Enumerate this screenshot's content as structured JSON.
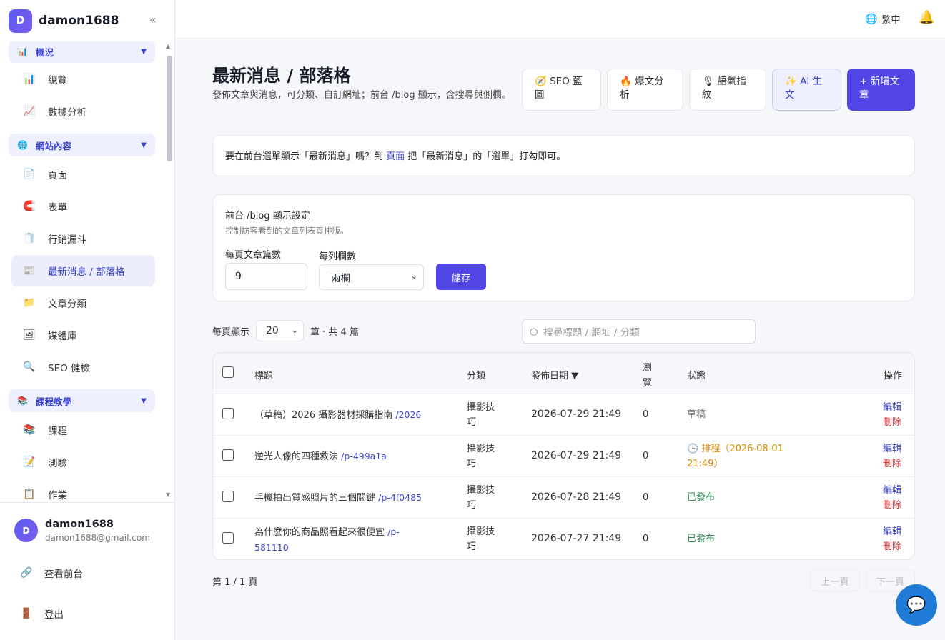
{
  "brand": {
    "initial": "D",
    "name": "damon1688",
    "collapse": "«"
  },
  "sidebar": {
    "groups": [
      {
        "icon": "📊",
        "label": "概況"
      },
      {
        "icon": "🌐",
        "label": "網站內容"
      },
      {
        "icon": "📚",
        "label": "課程教學"
      }
    ],
    "items": [
      {
        "icon": "📊",
        "label": "總覽"
      },
      {
        "icon": "📈",
        "label": "數據分析"
      },
      {
        "icon": "📄",
        "label": "頁面"
      },
      {
        "icon": "🧲",
        "label": "表單"
      },
      {
        "icon": "🧻",
        "label": "行銷漏斗"
      },
      {
        "icon": "📰",
        "label": "最新消息 / 部落格"
      },
      {
        "icon": "📁",
        "label": "文章分類"
      },
      {
        "icon": "🖼",
        "label": "媒體庫"
      },
      {
        "icon": "🔍",
        "label": "SEO 健檢"
      },
      {
        "icon": "📚",
        "label": "課程"
      },
      {
        "icon": "📝",
        "label": "測驗"
      },
      {
        "icon": "📋",
        "label": "作業"
      }
    ],
    "caret": "▼"
  },
  "user": {
    "initial": "D",
    "name": "damon1688",
    "email": "damon1688@gmail.com"
  },
  "footer_links": [
    {
      "icon": "🔗",
      "label": "查看前台"
    },
    {
      "icon": "🚪",
      "label": "登出"
    }
  ],
  "topbar": {
    "lang": "繁中",
    "globe": "🌐",
    "bell": "🔔"
  },
  "page": {
    "title": "最新消息 / 部落格",
    "desc": "發佈文章與消息，可分類、自訂網址；前台 /blog 顯示，含搜尋與側欄。"
  },
  "header_buttons": {
    "seo": {
      "line1": "🧭 SEO 藍",
      "line2": "圖"
    },
    "viral": {
      "line1": "🔥 爆文分",
      "line2": "析"
    },
    "tone": {
      "line1": "🎙 語氣指",
      "line2": "紋"
    },
    "ai": {
      "line1": "✨ AI 生",
      "line2": "文"
    },
    "new": {
      "line1": "+ 新增文",
      "line2": "章"
    }
  },
  "notice": {
    "before": "要在前台選單顯示「最新消息」嗎？到 ",
    "link": "頁面",
    "after": " 把「最新消息」的「選單」打勾即可。"
  },
  "settings": {
    "title": "前台 /blog 顯示設定",
    "subtitle": "控制訪客看到的文章列表頁排版。",
    "per_page_label": "每頁文章篇數",
    "per_page_value": "9",
    "cols_label": "每列欄數",
    "cols_value": "兩欄",
    "save": "儲存"
  },
  "list": {
    "per_page_prefix": "每頁顯示",
    "per_page_value": "20",
    "count_text": "筆 · 共 4 篇",
    "search_placeholder": "搜尋標題 / 網址 / 分類"
  },
  "table": {
    "headers": {
      "title": "標題",
      "category": "分類",
      "date": "發佈日期 ▼",
      "views1": "瀏",
      "views2": "覽",
      "status": "狀態",
      "actions": "操作"
    },
    "rows": [
      {
        "title": "（草稿）2026 攝影器材採購指南",
        "slug": "/2026",
        "cat1": "攝影技",
        "cat2": "巧",
        "date": "2026-07-29 21:49",
        "views": "0",
        "status1": "草稿",
        "status2": "",
        "edit": "編輯",
        "delete": "刪除"
      },
      {
        "title": "逆光人像的四種救法",
        "slug": "/p-499a1a",
        "cat1": "攝影技",
        "cat2": "巧",
        "date": "2026-07-29 21:49",
        "views": "0",
        "status1": "🕒 排程（2026-08-01",
        "status2": "21:49）",
        "edit": "編輯",
        "delete": "刪除"
      },
      {
        "title": "手機拍出質感照片的三個關鍵",
        "slug": "/p-4f0485",
        "cat1": "攝影技",
        "cat2": "巧",
        "date": "2026-07-28 21:49",
        "views": "0",
        "status1": "已發布",
        "status2": "",
        "edit": "編輯",
        "delete": "刪除"
      },
      {
        "title": "為什麼你的商品照看起來很便宜",
        "slug": "/p-",
        "slug2": "581110",
        "cat1": "攝影技",
        "cat2": "巧",
        "date": "2026-07-27 21:49",
        "views": "0",
        "status1": "已發布",
        "status2": "",
        "edit": "編輯",
        "delete": "刪除"
      }
    ]
  },
  "pager": {
    "info": "第 1 / 1 頁",
    "prev": "上一頁",
    "next": "下一頁"
  }
}
